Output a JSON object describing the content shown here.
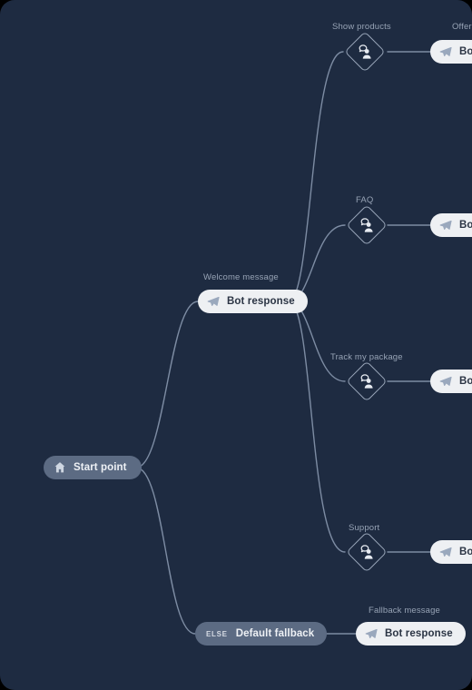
{
  "canvas": {
    "background_color": "#1e2b41",
    "edge_color": "#7d8ca3",
    "caption_color": "#97a3b5"
  },
  "nodes": {
    "start": {
      "label": "Start point",
      "icon": "home-icon",
      "color": "#5c6b83"
    },
    "welcome": {
      "caption": "Welcome message",
      "label": "Bot response",
      "icon": "send-icon",
      "color": "#eef0f3"
    },
    "fallback_condition": {
      "badge": "ELSE",
      "label": "Default fallback",
      "color": "#5c6b83"
    },
    "fallback_response": {
      "caption": "Fallback message",
      "label": "Bot response",
      "icon": "send-icon",
      "color": "#eef0f3"
    }
  },
  "branches": [
    {
      "caption": "Show products",
      "icon": "user-intent-icon",
      "response": {
        "caption": "Offer",
        "label": "Bot response",
        "icon": "send-icon"
      }
    },
    {
      "caption": "FAQ",
      "icon": "user-intent-icon",
      "response": {
        "caption": "",
        "label": "Bot response",
        "icon": "send-icon"
      }
    },
    {
      "caption": "Track my package",
      "icon": "user-intent-icon",
      "response": {
        "caption": "",
        "label": "Bot response",
        "icon": "send-icon"
      }
    },
    {
      "caption": "Support",
      "icon": "user-intent-icon",
      "response": {
        "caption": "",
        "label": "Bot response",
        "icon": "send-icon"
      }
    }
  ]
}
